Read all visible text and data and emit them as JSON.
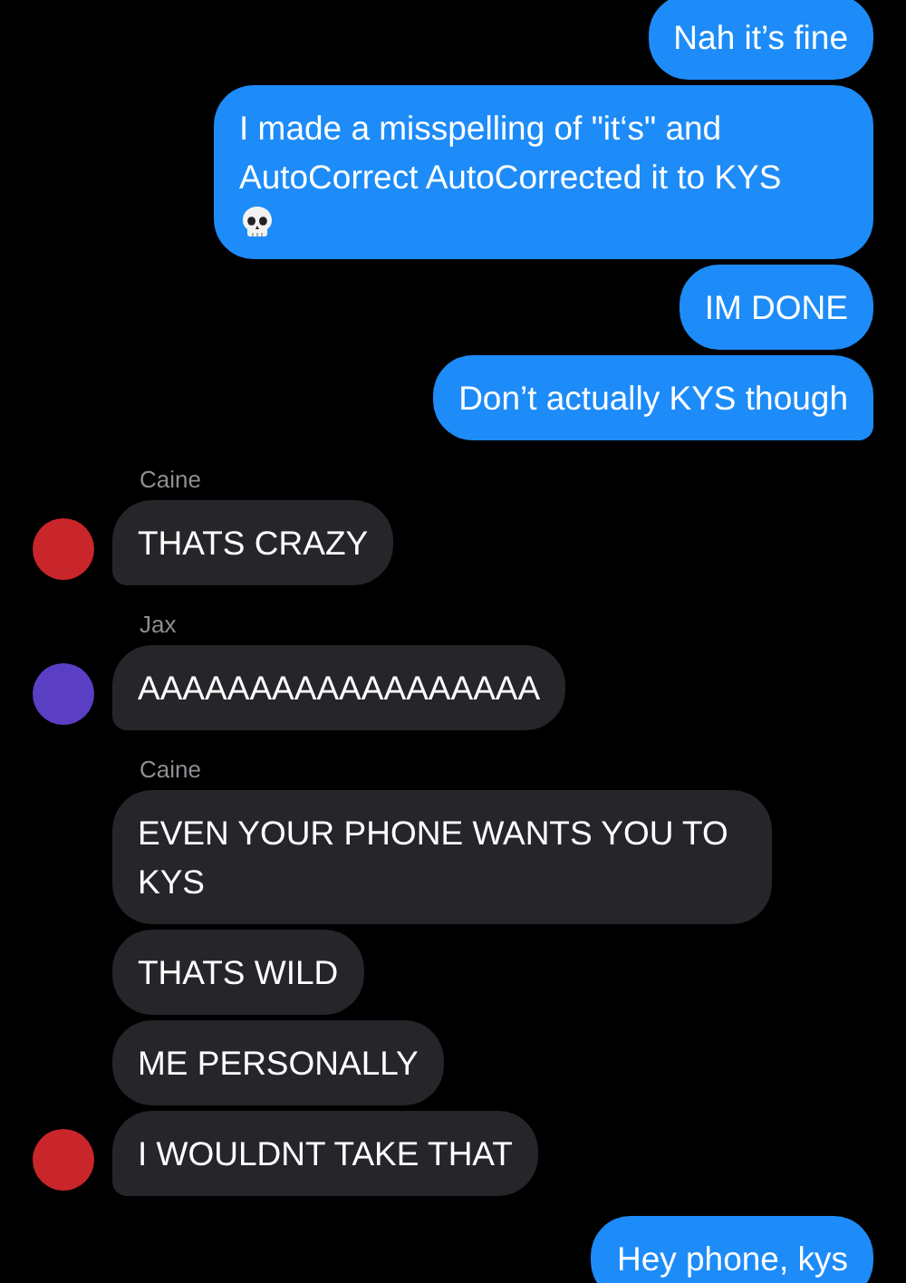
{
  "messages": [
    {
      "kind": "outgoing",
      "text": "Nah it’s fine",
      "tail": false
    },
    {
      "kind": "outgoing",
      "text": "I made a misspelling of \"it‘s\" and AutoCorrect AutoCorrected it to KYS",
      "skull_emoji": true,
      "tail": false
    },
    {
      "kind": "outgoing",
      "text": "IM DONE",
      "tail": false
    },
    {
      "kind": "outgoing",
      "text": "Don’t actually KYS though",
      "tail": true
    },
    {
      "kind": "sender",
      "text": "Caine"
    },
    {
      "kind": "incoming",
      "text": "THATS CRAZY",
      "avatar": true,
      "color": "#c8262b",
      "tail": true
    },
    {
      "kind": "sender",
      "text": "Jax"
    },
    {
      "kind": "incoming",
      "text": "AAAAAAAAAAAAAAAAAA",
      "avatar": true,
      "color": "#5a3fc4",
      "tail": true
    },
    {
      "kind": "sender",
      "text": "Caine"
    },
    {
      "kind": "incoming",
      "text": "EVEN YOUR PHONE WANTS YOU TO KYS",
      "avatar": false,
      "tail": false
    },
    {
      "kind": "incoming",
      "text": "THATS WILD",
      "avatar": false,
      "tail": false
    },
    {
      "kind": "incoming",
      "text": "ME PERSONALLY",
      "avatar": false,
      "tail": false
    },
    {
      "kind": "incoming",
      "text": "I WOULDNT TAKE THAT",
      "avatar": true,
      "color": "#c8262b",
      "tail": true
    },
    {
      "kind": "outgoing",
      "text": "Hey phone, kys",
      "tail": false
    }
  ]
}
